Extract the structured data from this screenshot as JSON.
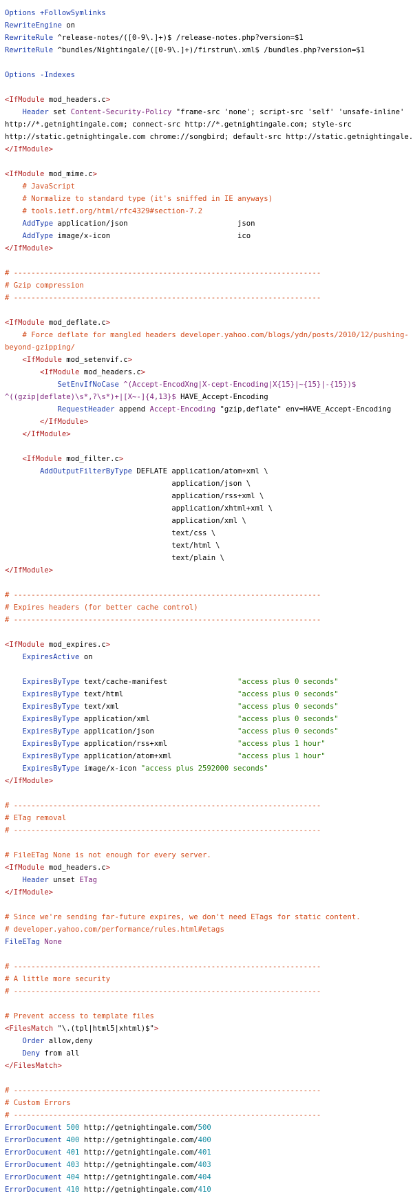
{
  "colors": {
    "tag": "#b01e1e",
    "directive": "#1f3fae",
    "string": "#2b7a0b",
    "number": "#0f8aa0",
    "variable": "#7a1f7a",
    "comment": "#d24b1b",
    "text": "#000000",
    "background": "#ffffff"
  },
  "lines": [
    [
      {
        "t": "Options ",
        "c": "dir"
      },
      {
        "t": "+FollowSymlinks",
        "c": "dir"
      }
    ],
    [
      {
        "t": "RewriteEngine ",
        "c": "dir"
      },
      {
        "t": "on",
        "c": "plain"
      }
    ],
    [
      {
        "t": "RewriteRule ",
        "c": "dir"
      },
      {
        "t": "^release-notes/([0-9\\.]+)$ /release-notes.php?version=$1",
        "c": "plain"
      }
    ],
    [
      {
        "t": "RewriteRule ",
        "c": "dir"
      },
      {
        "t": "^bundles/Nightingale/([0-9\\.]+)/firstrun\\.xml$ /bundles.php?version=$1",
        "c": "plain"
      }
    ],
    [],
    [
      {
        "t": "Options ",
        "c": "dir"
      },
      {
        "t": "-Indexes",
        "c": "dir"
      }
    ],
    [],
    [
      {
        "t": "<IfModule ",
        "c": "tag"
      },
      {
        "t": "mod_headers.c",
        "c": "plain"
      },
      {
        "t": ">",
        "c": "tag"
      }
    ],
    [
      {
        "t": "    Header ",
        "c": "dir"
      },
      {
        "t": "set ",
        "c": "plain"
      },
      {
        "t": "Content-Security-Policy ",
        "c": "var"
      },
      {
        "t": "\"frame-src 'none'; script-src 'self' 'unsafe-inline'",
        "c": "plain"
      }
    ],
    [
      {
        "t": "http://*.getnightingale.com; connect-src http://*.getnightingale.com; style-src",
        "c": "plain"
      }
    ],
    [
      {
        "t": "http://static.getnightingale.com chrome://songbird; default-src http://static.getnightingale.com\"",
        "c": "plain"
      }
    ],
    [
      {
        "t": "</IfModule>",
        "c": "tag"
      }
    ],
    [],
    [
      {
        "t": "<IfModule ",
        "c": "tag"
      },
      {
        "t": "mod_mime.c",
        "c": "plain"
      },
      {
        "t": ">",
        "c": "tag"
      }
    ],
    [
      {
        "t": "    # JavaScript",
        "c": "cmt"
      }
    ],
    [
      {
        "t": "    # Normalize to standard type (it's sniffed in IE anyways)",
        "c": "cmt"
      }
    ],
    [
      {
        "t": "    # tools.ietf.org/html/rfc4329#section-7.2",
        "c": "cmt"
      }
    ],
    [
      {
        "t": "    AddType ",
        "c": "dir"
      },
      {
        "t": "application/json                         json",
        "c": "plain"
      }
    ],
    [
      {
        "t": "    AddType ",
        "c": "dir"
      },
      {
        "t": "image/x-icon                             ico",
        "c": "plain"
      }
    ],
    [
      {
        "t": "</IfModule>",
        "c": "tag"
      }
    ],
    [],
    [
      {
        "t": "# ----------------------------------------------------------------------",
        "c": "cmt"
      }
    ],
    [
      {
        "t": "# Gzip compression",
        "c": "cmt"
      }
    ],
    [
      {
        "t": "# ----------------------------------------------------------------------",
        "c": "cmt"
      }
    ],
    [],
    [
      {
        "t": "<IfModule ",
        "c": "tag"
      },
      {
        "t": "mod_deflate.c",
        "c": "plain"
      },
      {
        "t": ">",
        "c": "tag"
      }
    ],
    [
      {
        "t": "    # Force deflate for mangled headers developer.yahoo.com/blogs/ydn/posts/2010/12/pushing-",
        "c": "cmt"
      }
    ],
    [
      {
        "t": "beyond-gzipping/",
        "c": "cmt"
      }
    ],
    [
      {
        "t": "    <IfModule ",
        "c": "tag"
      },
      {
        "t": "mod_setenvif.c",
        "c": "plain"
      },
      {
        "t": ">",
        "c": "tag"
      }
    ],
    [
      {
        "t": "        <IfModule ",
        "c": "tag"
      },
      {
        "t": "mod_headers.c",
        "c": "plain"
      },
      {
        "t": ">",
        "c": "tag"
      }
    ],
    [
      {
        "t": "            SetEnvIfNoCase ",
        "c": "dir"
      },
      {
        "t": "^(Accept-EncodXng|X-cept-Encoding|X{15}|~{15}|-{15})$",
        "c": "var"
      }
    ],
    [
      {
        "t": "^((gzip|deflate)\\s*,?\\s*)+|[X~-]{4,13}$ ",
        "c": "var"
      },
      {
        "t": "HAVE_Accept-Encoding",
        "c": "plain"
      }
    ],
    [
      {
        "t": "            RequestHeader ",
        "c": "dir"
      },
      {
        "t": "append ",
        "c": "plain"
      },
      {
        "t": "Accept-Encoding ",
        "c": "var"
      },
      {
        "t": "\"gzip,deflate\" ",
        "c": "plain"
      },
      {
        "t": "env=HAVE_Accept-Encoding",
        "c": "plain"
      }
    ],
    [
      {
        "t": "        </IfModule>",
        "c": "tag"
      }
    ],
    [
      {
        "t": "    </IfModule>",
        "c": "tag"
      }
    ],
    [],
    [
      {
        "t": "    <IfModule ",
        "c": "tag"
      },
      {
        "t": "mod_filter.c",
        "c": "plain"
      },
      {
        "t": ">",
        "c": "tag"
      }
    ],
    [
      {
        "t": "        AddOutputFilterByType ",
        "c": "dir"
      },
      {
        "t": "DEFLATE application/atom+xml \\",
        "c": "plain"
      }
    ],
    [
      {
        "t": "                                      application/json \\",
        "c": "plain"
      }
    ],
    [
      {
        "t": "                                      application/rss+xml \\",
        "c": "plain"
      }
    ],
    [
      {
        "t": "                                      application/xhtml+xml \\",
        "c": "plain"
      }
    ],
    [
      {
        "t": "                                      application/xml \\",
        "c": "plain"
      }
    ],
    [
      {
        "t": "                                      text/css \\",
        "c": "plain"
      }
    ],
    [
      {
        "t": "                                      text/html \\",
        "c": "plain"
      }
    ],
    [
      {
        "t": "                                      text/plain \\",
        "c": "plain"
      }
    ],
    [
      {
        "t": "</IfModule>",
        "c": "tag"
      }
    ],
    [],
    [
      {
        "t": "# ----------------------------------------------------------------------",
        "c": "cmt"
      }
    ],
    [
      {
        "t": "# Expires headers (for better cache control)",
        "c": "cmt"
      }
    ],
    [
      {
        "t": "# ----------------------------------------------------------------------",
        "c": "cmt"
      }
    ],
    [],
    [
      {
        "t": "<IfModule ",
        "c": "tag"
      },
      {
        "t": "mod_expires.c",
        "c": "plain"
      },
      {
        "t": ">",
        "c": "tag"
      }
    ],
    [
      {
        "t": "    ExpiresActive ",
        "c": "dir"
      },
      {
        "t": "on",
        "c": "plain"
      }
    ],
    [],
    [
      {
        "t": "    ExpiresByType ",
        "c": "dir"
      },
      {
        "t": "text/cache-manifest                ",
        "c": "plain"
      },
      {
        "t": "\"access plus 0 seconds\"",
        "c": "str"
      }
    ],
    [
      {
        "t": "    ExpiresByType ",
        "c": "dir"
      },
      {
        "t": "text/html                          ",
        "c": "plain"
      },
      {
        "t": "\"access plus 0 seconds\"",
        "c": "str"
      }
    ],
    [
      {
        "t": "    ExpiresByType ",
        "c": "dir"
      },
      {
        "t": "text/xml                           ",
        "c": "plain"
      },
      {
        "t": "\"access plus 0 seconds\"",
        "c": "str"
      }
    ],
    [
      {
        "t": "    ExpiresByType ",
        "c": "dir"
      },
      {
        "t": "application/xml                    ",
        "c": "plain"
      },
      {
        "t": "\"access plus 0 seconds\"",
        "c": "str"
      }
    ],
    [
      {
        "t": "    ExpiresByType ",
        "c": "dir"
      },
      {
        "t": "application/json                   ",
        "c": "plain"
      },
      {
        "t": "\"access plus 0 seconds\"",
        "c": "str"
      }
    ],
    [
      {
        "t": "    ExpiresByType ",
        "c": "dir"
      },
      {
        "t": "application/rss+xml                ",
        "c": "plain"
      },
      {
        "t": "\"access plus 1 hour\"",
        "c": "str"
      }
    ],
    [
      {
        "t": "    ExpiresByType ",
        "c": "dir"
      },
      {
        "t": "application/atom+xml               ",
        "c": "plain"
      },
      {
        "t": "\"access plus 1 hour\"",
        "c": "str"
      }
    ],
    [
      {
        "t": "    ExpiresByType ",
        "c": "dir"
      },
      {
        "t": "image/x-icon ",
        "c": "plain"
      },
      {
        "t": "\"access plus 2592000 seconds\"",
        "c": "str"
      }
    ],
    [
      {
        "t": "</IfModule>",
        "c": "tag"
      }
    ],
    [],
    [
      {
        "t": "# ----------------------------------------------------------------------",
        "c": "cmt"
      }
    ],
    [
      {
        "t": "# ETag removal",
        "c": "cmt"
      }
    ],
    [
      {
        "t": "# ----------------------------------------------------------------------",
        "c": "cmt"
      }
    ],
    [],
    [
      {
        "t": "# FileETag None is not enough for every server.",
        "c": "cmt"
      }
    ],
    [
      {
        "t": "<IfModule ",
        "c": "tag"
      },
      {
        "t": "mod_headers.c",
        "c": "plain"
      },
      {
        "t": ">",
        "c": "tag"
      }
    ],
    [
      {
        "t": "    Header ",
        "c": "dir"
      },
      {
        "t": "unset ",
        "c": "plain"
      },
      {
        "t": "ETag",
        "c": "var"
      }
    ],
    [
      {
        "t": "</IfModule>",
        "c": "tag"
      }
    ],
    [],
    [
      {
        "t": "# Since we're sending far-future expires, we don't need ETags for static content.",
        "c": "cmt"
      }
    ],
    [
      {
        "t": "# developer.yahoo.com/performance/rules.html#etags",
        "c": "cmt"
      }
    ],
    [
      {
        "t": "FileETag ",
        "c": "dir"
      },
      {
        "t": "None",
        "c": "var"
      }
    ],
    [],
    [
      {
        "t": "# ----------------------------------------------------------------------",
        "c": "cmt"
      }
    ],
    [
      {
        "t": "# A little more security",
        "c": "cmt"
      }
    ],
    [
      {
        "t": "# ----------------------------------------------------------------------",
        "c": "cmt"
      }
    ],
    [],
    [
      {
        "t": "# Prevent access to template files",
        "c": "cmt"
      }
    ],
    [
      {
        "t": "<FilesMatch ",
        "c": "tag"
      },
      {
        "t": "\"\\.(tpl|html5|xhtml)$\"",
        "c": "plain"
      },
      {
        "t": ">",
        "c": "tag"
      }
    ],
    [
      {
        "t": "    Order ",
        "c": "dir"
      },
      {
        "t": "allow,deny",
        "c": "plain"
      }
    ],
    [
      {
        "t": "    Deny ",
        "c": "dir"
      },
      {
        "t": "from all",
        "c": "plain"
      }
    ],
    [
      {
        "t": "</FilesMatch>",
        "c": "tag"
      }
    ],
    [],
    [
      {
        "t": "# ----------------------------------------------------------------------",
        "c": "cmt"
      }
    ],
    [
      {
        "t": "# Custom Errors",
        "c": "cmt"
      }
    ],
    [
      {
        "t": "# ----------------------------------------------------------------------",
        "c": "cmt"
      }
    ],
    [
      {
        "t": "ErrorDocument ",
        "c": "dir"
      },
      {
        "t": "500 ",
        "c": "num"
      },
      {
        "t": "http://getnightingale.com/",
        "c": "plain"
      },
      {
        "t": "500",
        "c": "num"
      }
    ],
    [
      {
        "t": "ErrorDocument ",
        "c": "dir"
      },
      {
        "t": "400 ",
        "c": "num"
      },
      {
        "t": "http://getnightingale.com/",
        "c": "plain"
      },
      {
        "t": "400",
        "c": "num"
      }
    ],
    [
      {
        "t": "ErrorDocument ",
        "c": "dir"
      },
      {
        "t": "401 ",
        "c": "num"
      },
      {
        "t": "http://getnightingale.com/",
        "c": "plain"
      },
      {
        "t": "401",
        "c": "num"
      }
    ],
    [
      {
        "t": "ErrorDocument ",
        "c": "dir"
      },
      {
        "t": "403 ",
        "c": "num"
      },
      {
        "t": "http://getnightingale.com/",
        "c": "plain"
      },
      {
        "t": "403",
        "c": "num"
      }
    ],
    [
      {
        "t": "ErrorDocument ",
        "c": "dir"
      },
      {
        "t": "404 ",
        "c": "num"
      },
      {
        "t": "http://getnightingale.com/",
        "c": "plain"
      },
      {
        "t": "404",
        "c": "num"
      }
    ],
    [
      {
        "t": "ErrorDocument ",
        "c": "dir"
      },
      {
        "t": "410 ",
        "c": "num"
      },
      {
        "t": "http://getnightingale.com/",
        "c": "plain"
      },
      {
        "t": "410",
        "c": "num"
      }
    ]
  ]
}
